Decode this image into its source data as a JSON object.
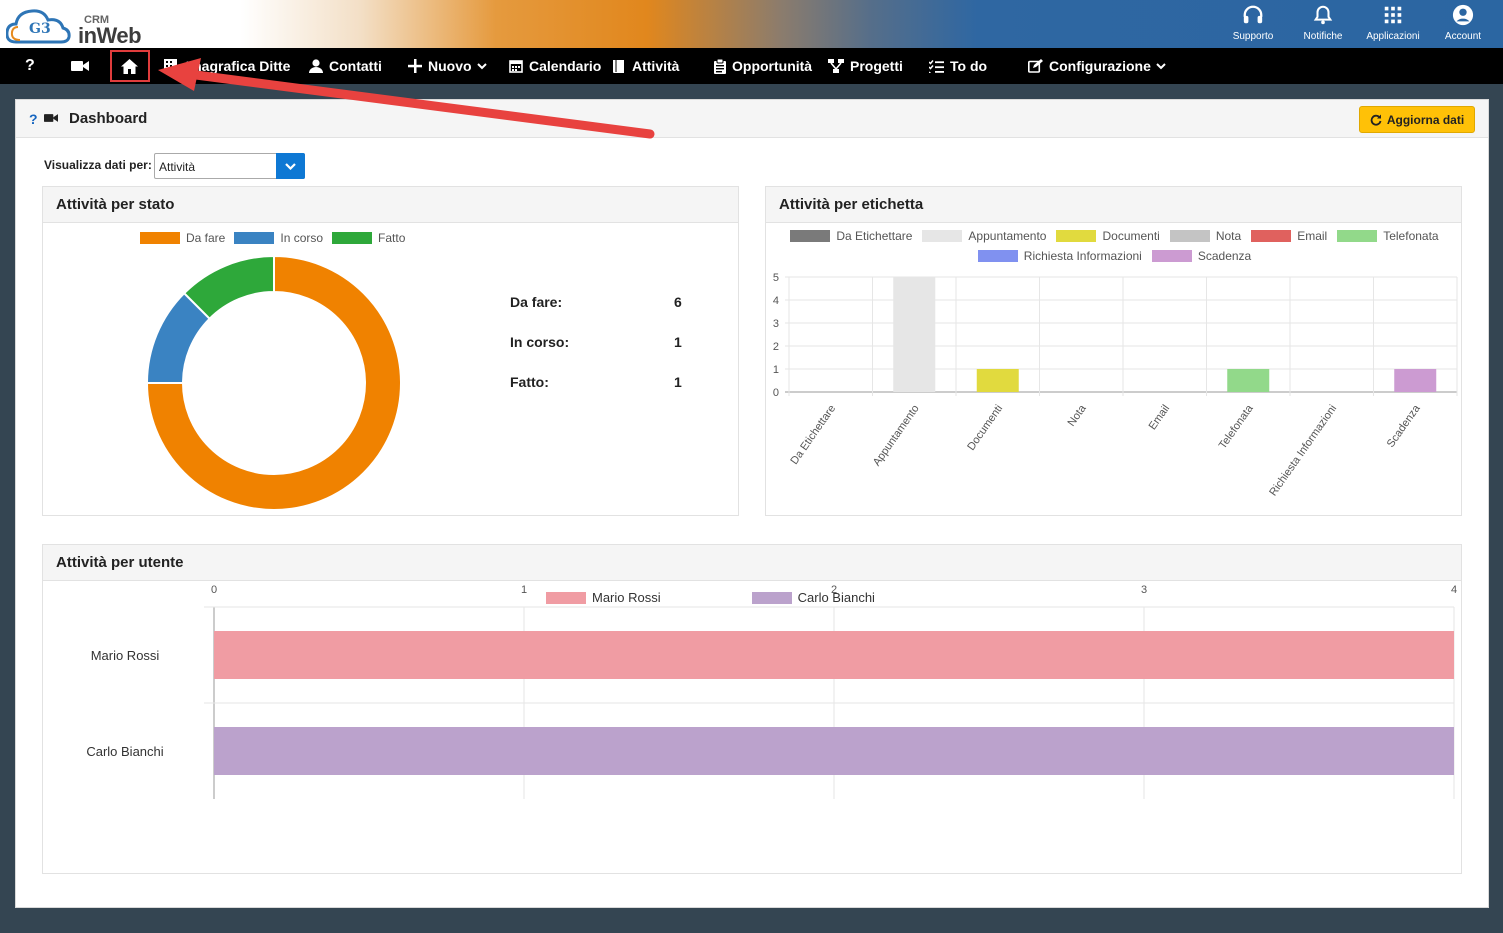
{
  "topbar": {
    "logo_small": "CRM",
    "logo_big": "inWeb",
    "logo_badge": "G3",
    "actions": [
      {
        "label": "Supporto",
        "icon": "headset-icon"
      },
      {
        "label": "Notifiche",
        "icon": "bell-icon"
      },
      {
        "label": "Applicazioni",
        "icon": "apps-grid-icon"
      },
      {
        "label": "Account",
        "icon": "user-circle-icon"
      }
    ]
  },
  "navbar": {
    "help": "?",
    "items": [
      {
        "label": "Anagrafica Ditte",
        "icon": "building-icon"
      },
      {
        "label": "Contatti",
        "icon": "user-icon"
      },
      {
        "label": "Nuovo",
        "icon": "plus-icon"
      },
      {
        "label": "Calendario",
        "icon": "calendar-icon"
      },
      {
        "label": "Attività",
        "icon": "book-icon"
      },
      {
        "label": "Opportunità",
        "icon": "clipboard-icon"
      },
      {
        "label": "Progetti",
        "icon": "sitemap-icon"
      },
      {
        "label": "To do",
        "icon": "list-check-icon"
      },
      {
        "label": "Configurazione",
        "icon": "edit-icon"
      }
    ]
  },
  "dashboard": {
    "help": "?",
    "title": "Dashboard",
    "refresh_label": "Aggiorna dati",
    "view_label": "Visualizza dati per:",
    "view_value": "Attività"
  },
  "colors": {
    "accent": "#ffc107",
    "select": "#0e78d4",
    "annotation": "#e03c3c"
  },
  "cards": {
    "stato": {
      "title": "Attività per stato"
    },
    "etichetta": {
      "title": "Attività per etichetta"
    },
    "utente": {
      "title": "Attività per utente"
    }
  },
  "stats": [
    {
      "label": "Da fare:",
      "value": "6"
    },
    {
      "label": "In corso:",
      "value": "1"
    },
    {
      "label": "Fatto:",
      "value": "1"
    }
  ],
  "chart_data": [
    {
      "type": "pie",
      "labels": [
        "Da fare",
        "In corso",
        "Fatto"
      ],
      "values": [
        6,
        1,
        1
      ],
      "colors": [
        "#f08200",
        "#3a83c2",
        "#2ea83a"
      ],
      "legend": "top"
    },
    {
      "type": "bar",
      "categories": [
        "Da Etichettare",
        "Appuntamento",
        "Documenti",
        "Nota",
        "Email",
        "Telefonata",
        "Richiesta Informazioni",
        "Scadenza"
      ],
      "values": [
        0,
        5,
        1,
        0,
        0,
        1,
        0,
        1
      ],
      "colors": [
        "#7a7a7a",
        "#e6e6e6",
        "#e1da3e",
        "#c4c4c4",
        "#e0615e",
        "#92d98a",
        "#8091f0",
        "#cc9bd2"
      ],
      "ylim": [
        0,
        5
      ],
      "yticks": [
        "0",
        "1",
        "2",
        "3",
        "4",
        "5"
      ],
      "legend": "top",
      "grid": true
    },
    {
      "type": "bar",
      "orientation": "horizontal",
      "categories": [
        "Mario Rossi",
        "Carlo Bianchi"
      ],
      "values": [
        4,
        4
      ],
      "colors": [
        "#f09ca3",
        "#bba2cc"
      ],
      "xlim": [
        0,
        4
      ],
      "xticks": [
        "0",
        "1",
        "2",
        "3",
        "4"
      ],
      "legend": "top",
      "grid": true
    }
  ]
}
